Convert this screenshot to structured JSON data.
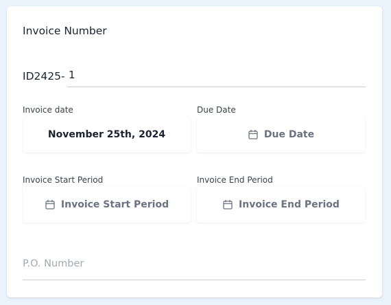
{
  "invoice_number": {
    "title": "Invoice Number",
    "prefix": "ID2425-",
    "value": "1"
  },
  "invoice_date": {
    "label": "Invoice date",
    "value": "November 25th, 2024"
  },
  "due_date": {
    "label": "Due Date",
    "placeholder": "Due Date"
  },
  "invoice_start_period": {
    "label": "Invoice Start Period",
    "placeholder": "Invoice Start Period"
  },
  "invoice_end_period": {
    "label": "Invoice End Period",
    "placeholder": "Invoice End Period"
  },
  "po_number": {
    "placeholder": "P.O. Number",
    "value": ""
  },
  "icons": {
    "calendar": "calendar-icon"
  },
  "colors": {
    "background": "#eaf3fc",
    "card": "#ffffff",
    "text": "#1d2230",
    "muted": "#6b7280",
    "placeholder": "#a3a8b0"
  }
}
